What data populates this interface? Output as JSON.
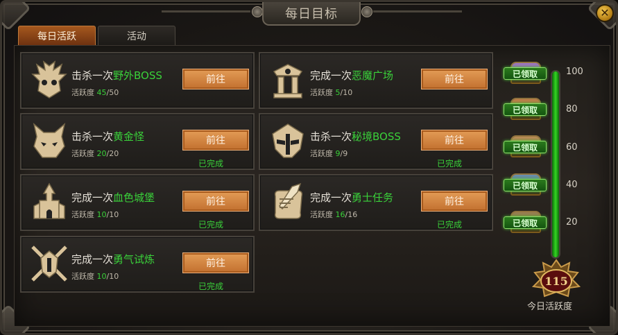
{
  "title": "每日目标",
  "tabs": [
    {
      "label": "每日活跃",
      "active": true
    },
    {
      "label": "活动",
      "active": false
    }
  ],
  "go_label": "前往",
  "done_label": "已完成",
  "progress_label": "活跃度",
  "tasks": [
    {
      "prefix": "击杀一次",
      "target": "野外BOSS",
      "current": "45",
      "max": "/50",
      "completed": false,
      "icon": "demon-skull-icon"
    },
    {
      "prefix": "完成一次",
      "target": "恶魔广场",
      "current": "5",
      "max": "/10",
      "completed": false,
      "icon": "altar-icon"
    },
    {
      "prefix": "击杀一次",
      "target": "黄金怪",
      "current": "20",
      "max": "/20",
      "completed": true,
      "icon": "horned-demon-icon"
    },
    {
      "prefix": "击杀一次",
      "target": "秘境BOSS",
      "current": "9",
      "max": "/9",
      "completed": true,
      "icon": "helmet-icon"
    },
    {
      "prefix": "完成一次",
      "target": "血色城堡",
      "current": "10",
      "max": "/10",
      "completed": true,
      "icon": "castle-icon"
    },
    {
      "prefix": "完成一次",
      "target": "勇士任务",
      "current": "16",
      "max": "/16",
      "completed": true,
      "icon": "scroll-sword-icon"
    },
    {
      "prefix": "完成一次",
      "target": "勇气试炼",
      "current": "10",
      "max": "/10",
      "completed": true,
      "icon": "crossed-swords-helmet-icon"
    }
  ],
  "rewards": [
    {
      "threshold": "100",
      "claimed_label": "已领取",
      "chest_color": "#8e5fbf"
    },
    {
      "threshold": "80",
      "claimed_label": "已领取",
      "chest_color": "#b76b2c"
    },
    {
      "threshold": "60",
      "claimed_label": "已领取",
      "chest_color": "#b07a3a"
    },
    {
      "threshold": "40",
      "claimed_label": "已领取",
      "chest_color": "#4f7da6"
    },
    {
      "threshold": "20",
      "claimed_label": "已领取",
      "chest_color": "#8b6a35"
    }
  ],
  "activity": {
    "total": "115",
    "label": "今日活跃度",
    "fill_fraction": 1.0
  },
  "colors": {
    "highlight": "#3ad13a",
    "button": "#d78a46",
    "active_tab": "#8c4418"
  }
}
